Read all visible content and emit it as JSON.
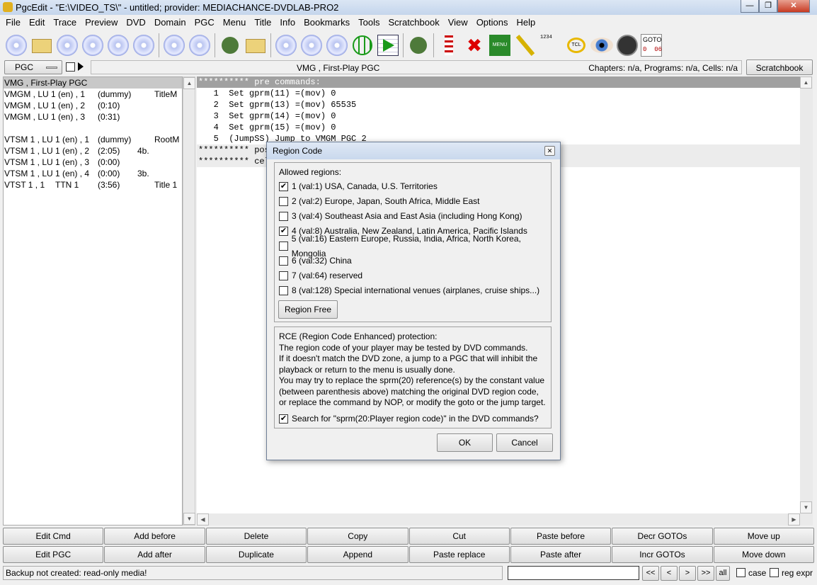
{
  "window": {
    "title": "PgcEdit -   \"E:\\VIDEO_TS\\\" - untitled; provider: MEDIACHANCE-DVDLAB-PRO2",
    "controls": [
      "minimize",
      "restore",
      "close"
    ]
  },
  "menu": [
    "File",
    "Edit",
    "Trace",
    "Preview",
    "DVD",
    "Domain",
    "PGC",
    "Menu",
    "Title",
    "Info",
    "Bookmarks",
    "Tools",
    "Scratchbook",
    "View",
    "Options",
    "Help"
  ],
  "toolbar": {
    "icons": [
      "open-dvd-icon",
      "open-folder-icon",
      "reopen-icon",
      "new-dvd-icon",
      "burn-icon",
      "search-disc-icon",
      "copy-disc-icon",
      "import-disc-icon",
      "edit-pen-icon",
      "edit-folder-icon",
      "check-disc-icon",
      "id-disc-icon",
      "disc-document-icon",
      "globe-icon",
      "play-table-icon",
      "film-reel-icon",
      "checklist-icon",
      "grid-x-icon",
      "menu-icon",
      "chain-icon",
      "numbers-icon",
      "tcl-icon",
      "eye-icon",
      "trace-icon"
    ],
    "menu_label": "MENU",
    "tcl_label": "TCL",
    "numbers_label": "1234",
    "goto_label": "GOTO",
    "goto_value": "0  06"
  },
  "selector": {
    "domain": "PGC",
    "current": "VMG , First-Play PGC",
    "info": "Chapters: n/a,  Programs: n/a,  Cells: n/a",
    "scratchbook": "Scratchbook"
  },
  "pgc_list": [
    {
      "name": "VMG , First-Play PGC",
      "time": "",
      "extra": "",
      "type": "",
      "selected": true
    },
    {
      "name": "VMGM , LU 1 (en) , 1",
      "time": "(dummy)",
      "extra": "",
      "type": "TitleM"
    },
    {
      "name": "VMGM , LU 1 (en) , 2",
      "time": "(0:10)",
      "extra": "",
      "type": ""
    },
    {
      "name": "VMGM , LU 1 (en) , 3",
      "time": "(0:31)",
      "extra": "",
      "type": ""
    },
    {
      "name": "",
      "time": "",
      "extra": "",
      "type": ""
    },
    {
      "name": "VTSM 1 , LU 1 (en) , 1",
      "time": "(dummy)",
      "extra": "",
      "type": "RootM"
    },
    {
      "name": "VTSM 1 , LU 1 (en) , 2",
      "time": "(2:05)",
      "extra": "4b.",
      "type": ""
    },
    {
      "name": "VTSM 1 , LU 1 (en) , 3",
      "time": "(0:00)",
      "extra": "",
      "type": ""
    },
    {
      "name": "VTSM 1 , LU 1 (en) , 4",
      "time": "(0:00)",
      "extra": "3b.",
      "type": ""
    },
    {
      "name": "VTST 1 , 1",
      "ttn": "TTN 1",
      "time": "(3:56)",
      "extra": "",
      "type": "Title 1"
    }
  ],
  "code": [
    {
      "text": "********** pre commands:",
      "style": "hl"
    },
    {
      "text": "   1  Set gprm(11) =(mov) 0",
      "style": ""
    },
    {
      "text": "   2  Set gprm(13) =(mov) 65535",
      "style": ""
    },
    {
      "text": "   3  Set gprm(14) =(mov) 0",
      "style": ""
    },
    {
      "text": "   4  Set gprm(15) =(mov) 0",
      "style": ""
    },
    {
      "text": "   5  (JumpSS) Jump to VMGM PGC 2",
      "style": ""
    },
    {
      "text": "********** post commands:",
      "style": "gr"
    },
    {
      "text": "********** cell commands:",
      "style": "gr"
    }
  ],
  "buttons": [
    "Edit Cmd",
    "Add before",
    "Delete",
    "Copy",
    "Cut",
    "Paste before",
    "Decr GOTOs",
    "Move up",
    "Edit PGC",
    "Add after",
    "Duplicate",
    "Append",
    "Paste replace",
    "Paste after",
    "Incr GOTOs",
    "Move down"
  ],
  "status": {
    "text": "Backup not created: read-only media!",
    "search_value": "",
    "nav": [
      "<<",
      "<",
      ">",
      ">>",
      "all"
    ],
    "case_label": "case",
    "regex_label": "reg expr",
    "case_checked": false,
    "regex_checked": false
  },
  "dialog": {
    "title": "Region Code",
    "allowed_label": "Allowed regions:",
    "regions": [
      {
        "label": "1 (val:1) USA, Canada, U.S. Territories",
        "checked": true
      },
      {
        "label": "2 (val:2) Europe, Japan, South Africa, Middle East",
        "checked": false
      },
      {
        "label": "3 (val:4) Southeast Asia and East Asia (including Hong Kong)",
        "checked": false
      },
      {
        "label": "4 (val:8) Australia, New Zealand, Latin America, Pacific Islands",
        "checked": true
      },
      {
        "label": "5 (val:16) Eastern Europe, Russia, India, Africa, North Korea, Mongolia",
        "checked": false
      },
      {
        "label": "6 (val:32) China",
        "checked": false
      },
      {
        "label": "7 (val:64) reserved",
        "checked": false
      },
      {
        "label": "8 (val:128) Special international venues (airplanes, cruise ships...)",
        "checked": false
      }
    ],
    "region_free": "Region Free",
    "rce_lines": [
      "RCE (Region Code Enhanced) protection:",
      "The region code of your player may be tested by DVD commands.",
      "If it doesn't match the DVD zone, a jump to a PGC that will inhibit the",
      "playback or return to the menu is usually done.",
      "You may try to replace the sprm(20) reference(s) by the constant value",
      "(between parenthesis above) matching the original DVD region code,",
      "or replace the command by NOP, or modify the goto or the jump target."
    ],
    "search_label": "Search for \"sprm(20:Player region code)\" in the DVD commands?",
    "search_checked": true,
    "ok": "OK",
    "cancel": "Cancel"
  }
}
